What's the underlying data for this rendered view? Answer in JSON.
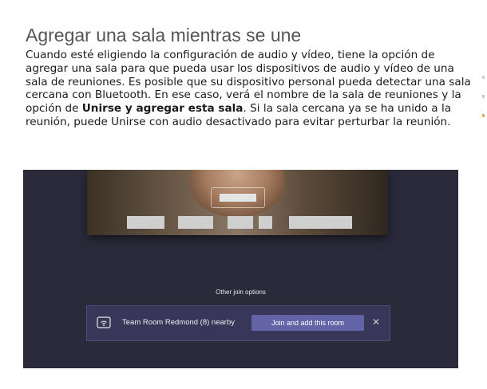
{
  "document": {
    "title": "Agregar una sala mientras se une",
    "paragraph": {
      "part1": "Cuando esté eligiendo la configuración de audio y vídeo, tiene la opción de agregar una sala para que pueda usar los dispositivos de audio y vídeo de una sala de reuniones. Es posible que su dispositivo personal pueda detectar una sala cercana con Bluetooth. En ese caso, verá el nombre de la sala de reuniones y la opción de ",
      "bold": "Unirse y agregar esta sala",
      "part2": ". Si la sala cercana ya se ha unido a la reunión, puede Unirse con audio desactivado para evitar perturbar la reunión."
    }
  },
  "screenshot": {
    "other_join_options": "Other join options",
    "room": {
      "icon": "wireless-display-icon",
      "name": "Team Room Redmond (8) nearby",
      "join_button": "Join and add this room",
      "close": "✕"
    },
    "colors": {
      "panel_bg": "#2b2a3b",
      "card_bg": "#38375a",
      "button_bg": "#6264a7"
    }
  }
}
